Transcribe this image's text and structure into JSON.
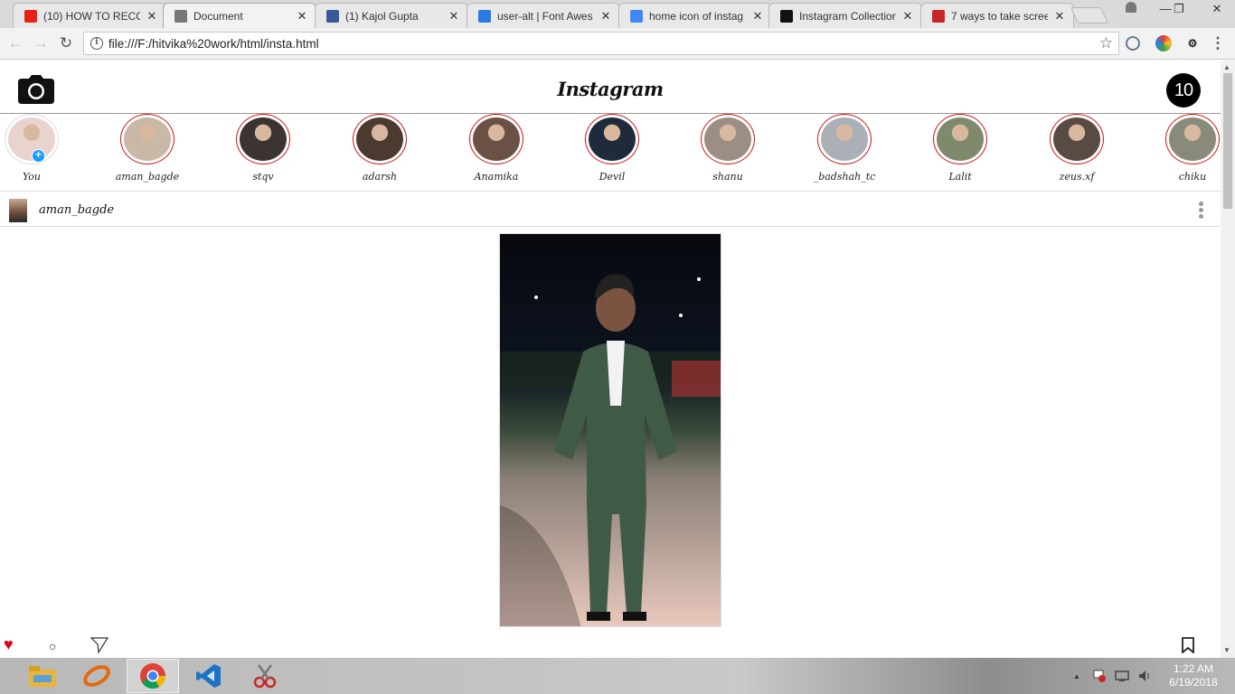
{
  "browser": {
    "tabs": [
      {
        "title": "(10) HOW TO RECOR",
        "icon": "youtube-icon",
        "color": "#e62117",
        "active": false
      },
      {
        "title": "Document",
        "icon": "document-icon",
        "color": "#777777",
        "active": true
      },
      {
        "title": "(1) Kajol Gupta",
        "icon": "facebook-icon",
        "color": "#3b5998",
        "active": false
      },
      {
        "title": "user-alt | Font Awes",
        "icon": "flag-icon",
        "color": "#2a7ae2",
        "active": false
      },
      {
        "title": "home icon of instag",
        "icon": "google-icon",
        "color": "#4285f4",
        "active": false
      },
      {
        "title": "Instagram Collection",
        "icon": "dots-icon",
        "color": "#111111",
        "active": false
      },
      {
        "title": "7 ways to take scree",
        "icon": "c-icon",
        "color": "#c62828",
        "active": false
      }
    ],
    "close_glyph": "✕",
    "url": "file:///F:/hitvika%20work/html/insta.html",
    "info_glyph": "i",
    "star_glyph": "☆",
    "back_glyph": "←",
    "forward_glyph": "→",
    "reload_glyph": "↻",
    "menu_glyph": "⋮",
    "window": {
      "user_glyph": "👤",
      "minimize": "—",
      "restore": "❐",
      "close": "✕"
    }
  },
  "app": {
    "brand": "Instagram",
    "notification_count": "10",
    "stories": [
      {
        "name": "You",
        "is_self": true,
        "tone": "#e8d4cc"
      },
      {
        "name": "aman_bagde",
        "tone": "#c9b8a6"
      },
      {
        "name": "stqv",
        "tone": "#3b3430"
      },
      {
        "name": "adarsh",
        "tone": "#4a3a30"
      },
      {
        "name": "Anamika",
        "tone": "#6b5145"
      },
      {
        "name": "Devil",
        "tone": "#1f2a3a"
      },
      {
        "name": "shanu",
        "tone": "#9c8e84"
      },
      {
        "name": "_badshah_tc",
        "tone": "#aab0b5"
      },
      {
        "name": "Lalit",
        "tone": "#7f8a6d"
      },
      {
        "name": "zeus.xf",
        "tone": "#5a4a44"
      },
      {
        "name": "chiku",
        "tone": "#8a8a7a"
      }
    ],
    "plus_glyph": "+",
    "post": {
      "username": "aman_bagde",
      "actions": {
        "like": "♥",
        "comment": "○",
        "share": "◁",
        "save": "▯"
      }
    }
  },
  "taskbar": {
    "time": "1:22 AM",
    "date": "6/19/2018",
    "apps": [
      "file-explorer-icon",
      "app-swirl-icon",
      "chrome-icon",
      "vscode-icon",
      "snipping-tool-icon"
    ],
    "tray_up": "▲"
  },
  "colors": {
    "story_ring": "#d31212",
    "like": "#e0001b",
    "plus_badge": "#1a9bff"
  }
}
